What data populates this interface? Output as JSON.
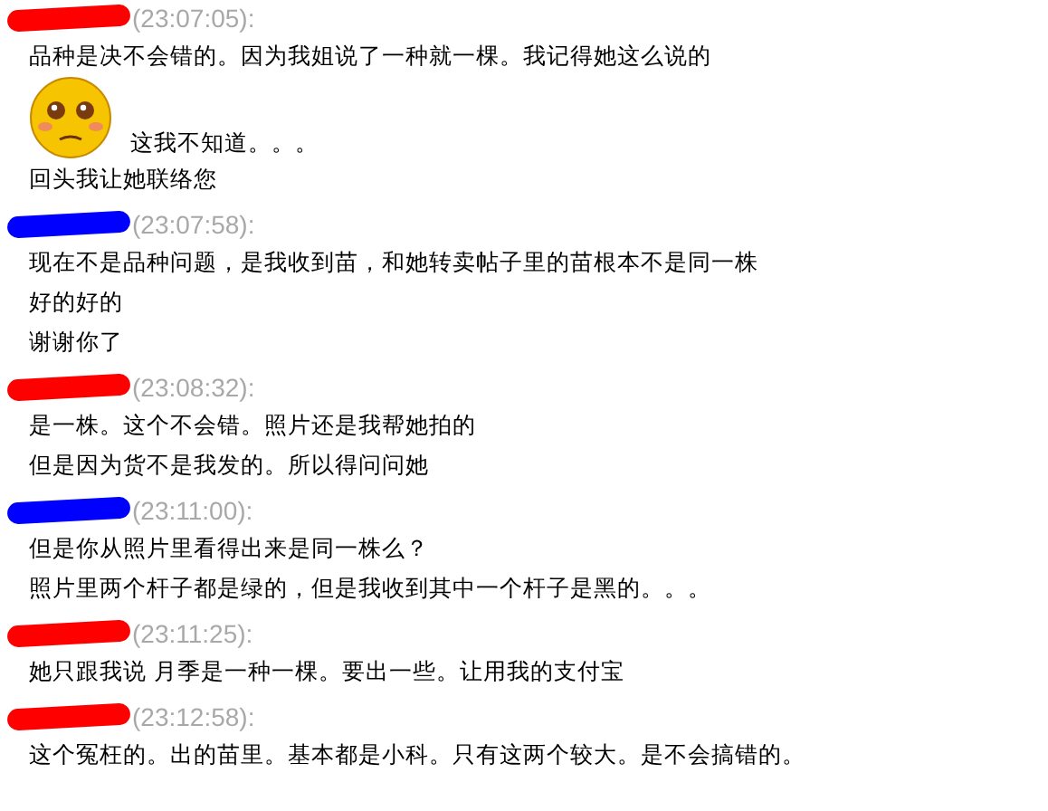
{
  "messages": [
    {
      "color": "#ff0000",
      "time": "(23:07:05):",
      "lines": [
        {
          "kind": "text",
          "text": "品种是决不会错的。因为我姐说了一种就一棵。我记得她这么说的"
        },
        {
          "kind": "emoticon",
          "text": "这我不知道。。。"
        },
        {
          "kind": "text",
          "text": "回头我让她联络您"
        }
      ]
    },
    {
      "color": "#0000ff",
      "time": "(23:07:58):",
      "lines": [
        {
          "kind": "text",
          "text": "现在不是品种问题，是我收到苗，和她转卖帖子里的苗根本不是同一株"
        },
        {
          "kind": "text",
          "text": "好的好的"
        },
        {
          "kind": "text",
          "text": "谢谢你了"
        }
      ]
    },
    {
      "color": "#ff0000",
      "time": "(23:08:32):",
      "lines": [
        {
          "kind": "text",
          "text": "是一株。这个不会错。照片还是我帮她拍的"
        },
        {
          "kind": "text",
          "text": "但是因为货不是我发的。所以得问问她"
        }
      ]
    },
    {
      "color": "#0000ff",
      "time": "(23:11:00):",
      "lines": [
        {
          "kind": "text",
          "text": "但是你从照片里看得出来是同一株么？"
        },
        {
          "kind": "text",
          "text": "照片里两个杆子都是绿的，但是我收到其中一个杆子是黑的。。。"
        }
      ]
    },
    {
      "color": "#ff0000",
      "time": "(23:11:25):",
      "lines": [
        {
          "kind": "text",
          "text": "她只跟我说  月季是一种一棵。要出一些。让用我的支付宝"
        }
      ]
    },
    {
      "color": "#ff0000",
      "time": "(23:12:58):",
      "lines": [
        {
          "kind": "text",
          "text": "这个冤枉的。出的苗里。基本都是小科。只有这两个较大。是不会搞错的。"
        }
      ]
    }
  ]
}
